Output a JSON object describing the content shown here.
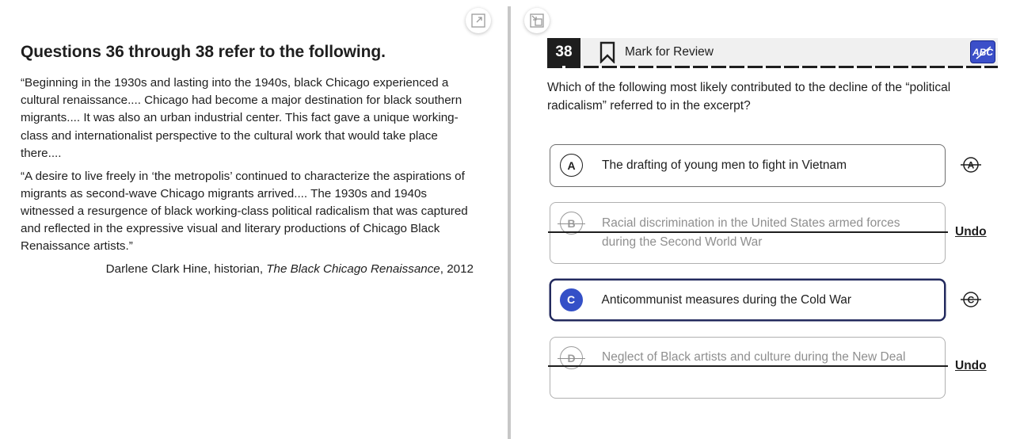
{
  "passage": {
    "heading": "Questions 36 through 38 refer to the following.",
    "paragraph_1": "“Beginning in the 1930s and lasting into the 1940s, black Chicago experienced a cultural renaissance.... Chicago had become a major destination for black southern migrants.... It was also an urban industrial center. This fact gave a unique working-class and internationalist perspective to the cultural work that would take place there....",
    "paragraph_2": "“A desire to live freely in ‘the metropolis’ continued to characterize the aspirations of migrants as second-wave Chicago migrants arrived.... The 1930s and 1940s witnessed a resurgence of black working-class political radicalism that was captured and reflected in the expressive visual and literary productions of Chicago Black Renaissance artists.”",
    "citation_author": "Darlene Clark Hine, historian, ",
    "citation_title": "The Black Chicago Renaissance",
    "citation_year": ", 2012"
  },
  "question": {
    "number": "38",
    "mark_for_review_label": "Mark for Review",
    "abc_label": "ABC",
    "prompt": "Which of the following most likely contributed to the decline of the “political radicalism” referred to in the excerpt?"
  },
  "choices": [
    {
      "letter": "A",
      "text": "The drafting of young men to fight in Vietnam",
      "state": "normal"
    },
    {
      "letter": "B",
      "text": "Racial discrimination in the United States armed forces during the Second World War",
      "state": "crossed",
      "undo_label": "Undo"
    },
    {
      "letter": "C",
      "text": "Anticommunist measures during the Cold War",
      "state": "selected"
    },
    {
      "letter": "D",
      "text": "Neglect of Black artists and culture during the New Deal",
      "state": "crossed",
      "undo_label": "Undo"
    }
  ],
  "colors": {
    "selected_accent": "#3450c7",
    "selected_border": "#232a5e",
    "abc_button": "#3b4fc9",
    "header_bg": "#f0f0f0"
  }
}
